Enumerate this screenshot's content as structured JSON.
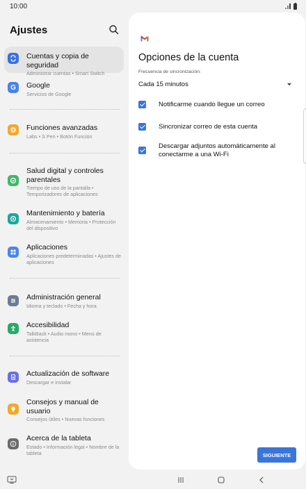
{
  "status_bar": {
    "time": "10:00"
  },
  "sidebar": {
    "title": "Ajustes",
    "items": [
      {
        "label": "Cuentas y copia de seguridad",
        "sub": "Administrar cuentas  •  Smart Switch",
        "icon": "accounts-sync-icon",
        "color": "#3a6fe0"
      },
      {
        "label": "Google",
        "sub": "Servicios de Google",
        "icon": "google-icon",
        "color": "#4a82e6"
      },
      {
        "label": "Funciones avanzadas",
        "sub": "Labs  •  S Pen  •  Botón Función",
        "icon": "advanced-features-icon",
        "color": "#f0a92a"
      },
      {
        "label": "Salud digital y controles parentales",
        "sub": "Tiempo de uso de la pantalla  •  Temporizadores de aplicaciones",
        "icon": "digital-wellbeing-icon",
        "color": "#3fb86a"
      },
      {
        "label": "Mantenimiento y batería",
        "sub": "Almacenamiento  •  Memoria  •  Protección del dispositivo",
        "icon": "device-care-icon",
        "color": "#1aa89a"
      },
      {
        "label": "Aplicaciones",
        "sub": "Aplicaciones predeterminadas  •  Ajustes de aplicaciones",
        "icon": "apps-icon",
        "color": "#4a86e8"
      },
      {
        "label": "Administración general",
        "sub": "Idioma y teclado  •  Fecha y hora",
        "icon": "general-management-icon",
        "color": "#6b7c94"
      },
      {
        "label": "Accesibilidad",
        "sub": "TalkBack  •  Audio mono  •  Menú de asistencia",
        "icon": "accessibility-icon",
        "color": "#2aa86a"
      },
      {
        "label": "Actualización de software",
        "sub": "Descargar e instalar",
        "icon": "software-update-icon",
        "color": "#6b6fe0"
      },
      {
        "label": "Consejos y manual de usuario",
        "sub": "Consejos útiles  •  Nuevas funciones",
        "icon": "tips-icon",
        "color": "#f0a92a"
      },
      {
        "label": "Acerca de la tableta",
        "sub": "Estado  •  Información legal  •  Nombre de la tableta",
        "icon": "about-info-icon",
        "color": "#6a6a6a"
      }
    ]
  },
  "panel": {
    "title": "Opciones de la cuenta",
    "sync_label": "Frecuencia de sincronización:",
    "sync_value": "Cada 15 minutos",
    "options": [
      {
        "label": "Notificarme cuando llegue un correo",
        "checked": true
      },
      {
        "label": "Sincronizar correo de esta cuenta",
        "checked": true
      },
      {
        "label": "Descargar adjuntos automáticamente al conectarme a una Wi-Fi",
        "checked": true
      }
    ],
    "next_label": "SIGUIENTE"
  },
  "colors": {
    "accent": "#3a76d8",
    "active_item": "#e4e4e4",
    "panel_bg": "#ffffff",
    "page_bg": "#f2f2f2"
  }
}
